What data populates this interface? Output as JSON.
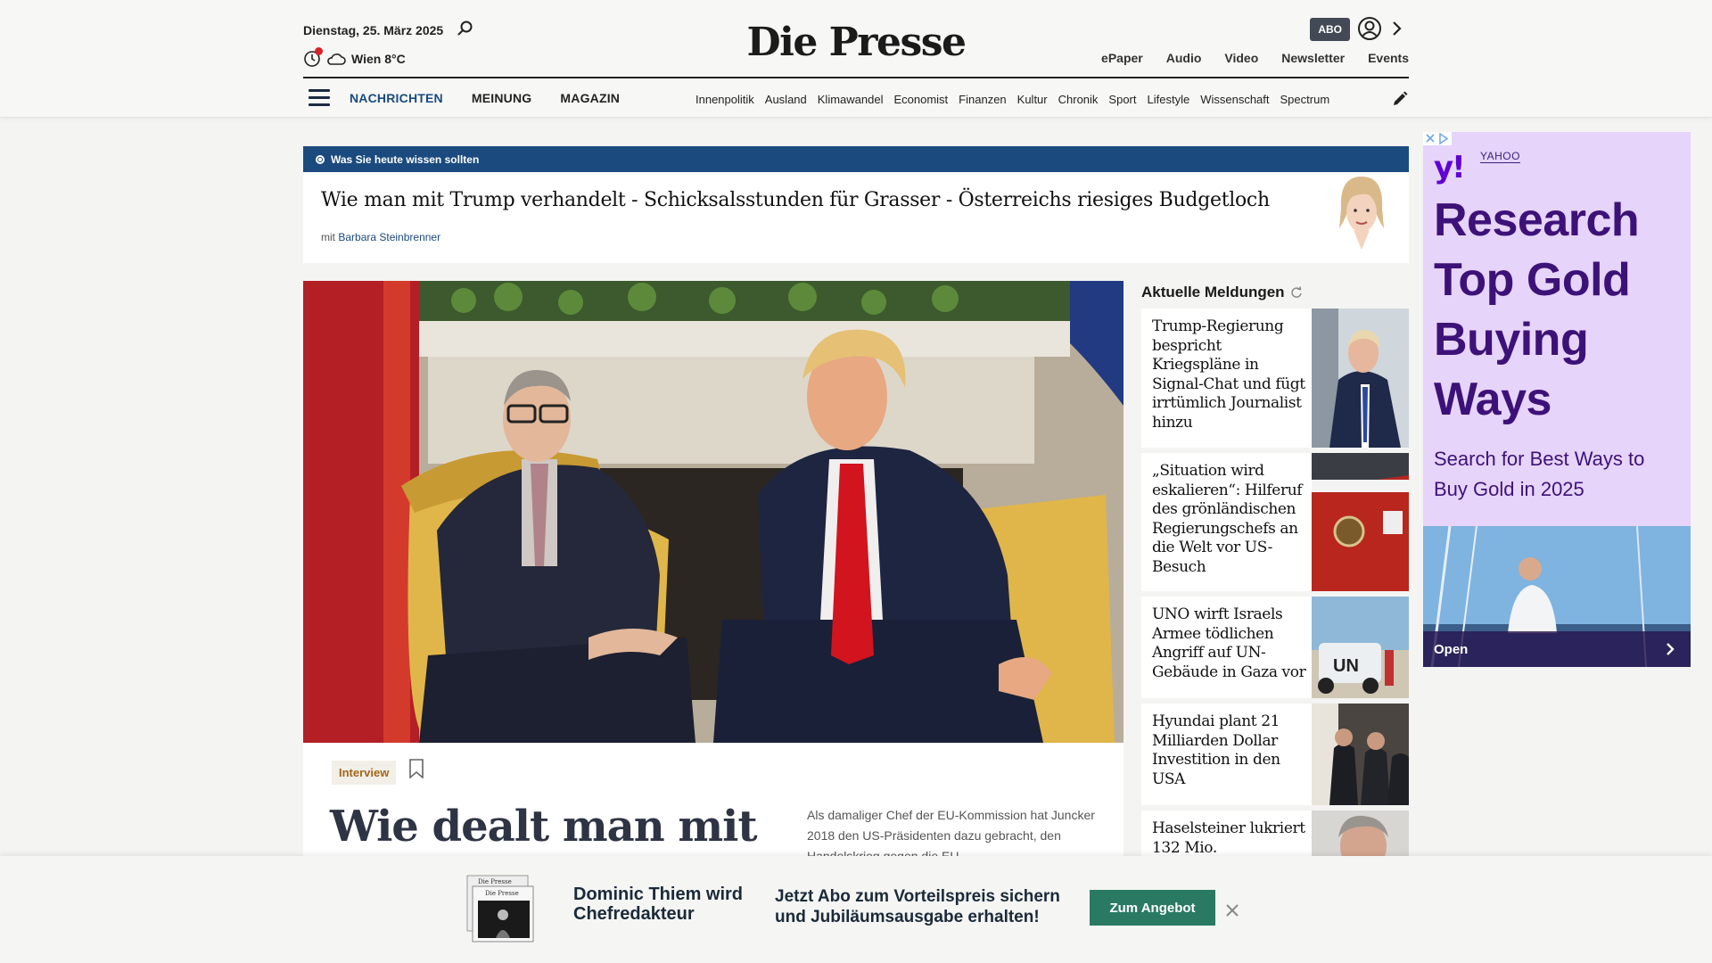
{
  "header": {
    "date": "Dienstag, 25. März 2025",
    "weather": "Wien 8°C",
    "logo": "Die Presse",
    "abo_label": "ABO",
    "top_links": [
      "ePaper",
      "Audio",
      "Video",
      "Newsletter",
      "Events"
    ],
    "main_nav": [
      "NACHRICHTEN",
      "MEINUNG",
      "MAGAZIN"
    ],
    "sub_nav": [
      "Innenpolitik",
      "Ausland",
      "Klimawandel",
      "Economist",
      "Finanzen",
      "Kultur",
      "Chronik",
      "Sport",
      "Lifestyle",
      "Wissenschaft",
      "Spectrum"
    ]
  },
  "briefing": {
    "label": "Was Sie heute wissen sollten",
    "headline": "Wie man mit Trump verhandelt - Schicksalsstunden für Grasser - Österreichs riesiges Budgetloch",
    "by_prefix": "mit",
    "author": "Barbara Steinbrenner"
  },
  "hero": {
    "tag": "Interview",
    "title": "Wie dealt man mit",
    "lead": "Als damaliger Chef der EU-Kommission hat Juncker 2018 den US-Präsidenten dazu gebracht, den Handelskrieg gegen die EU"
  },
  "news": {
    "title": "Aktuelle Meldungen",
    "items": [
      {
        "text": "Trump-Regierung bespricht Kriegspläne in Signal-Chat und fügt irrtümlich Journalist hinzu"
      },
      {
        "text": "„Situation wird eskalieren“: Hilferuf des grönländischen Regierungschefs an die Welt vor US-Besuch"
      },
      {
        "text": "UNO wirft Israels Armee tödlichen Angriff auf UN-Gebäude in Gaza vor"
      },
      {
        "text": "Hyundai plant 21 Milliarden Dollar Investition in den USA"
      },
      {
        "text": "Haselsteiner lukriert 132 Mio."
      }
    ]
  },
  "ad": {
    "logo": "y!",
    "brand": "YAHOO",
    "headline": "Research Top Gold Buying Ways",
    "sub": "Search for Best Ways to Buy Gold in 2025",
    "open_label": "Open"
  },
  "banner": {
    "headline": "Dominic Thiem wird Chefredakteur",
    "text": "Jetzt Abo zum Vorteilspreis sichern und Jubiläumsausgabe erhalten!",
    "button": "Zum Angebot"
  },
  "colors": {
    "brand_blue": "#1b4a7e",
    "banner_green": "#2a7a63",
    "ad_purple": "#3d1278",
    "alert_red": "#d8232a"
  }
}
